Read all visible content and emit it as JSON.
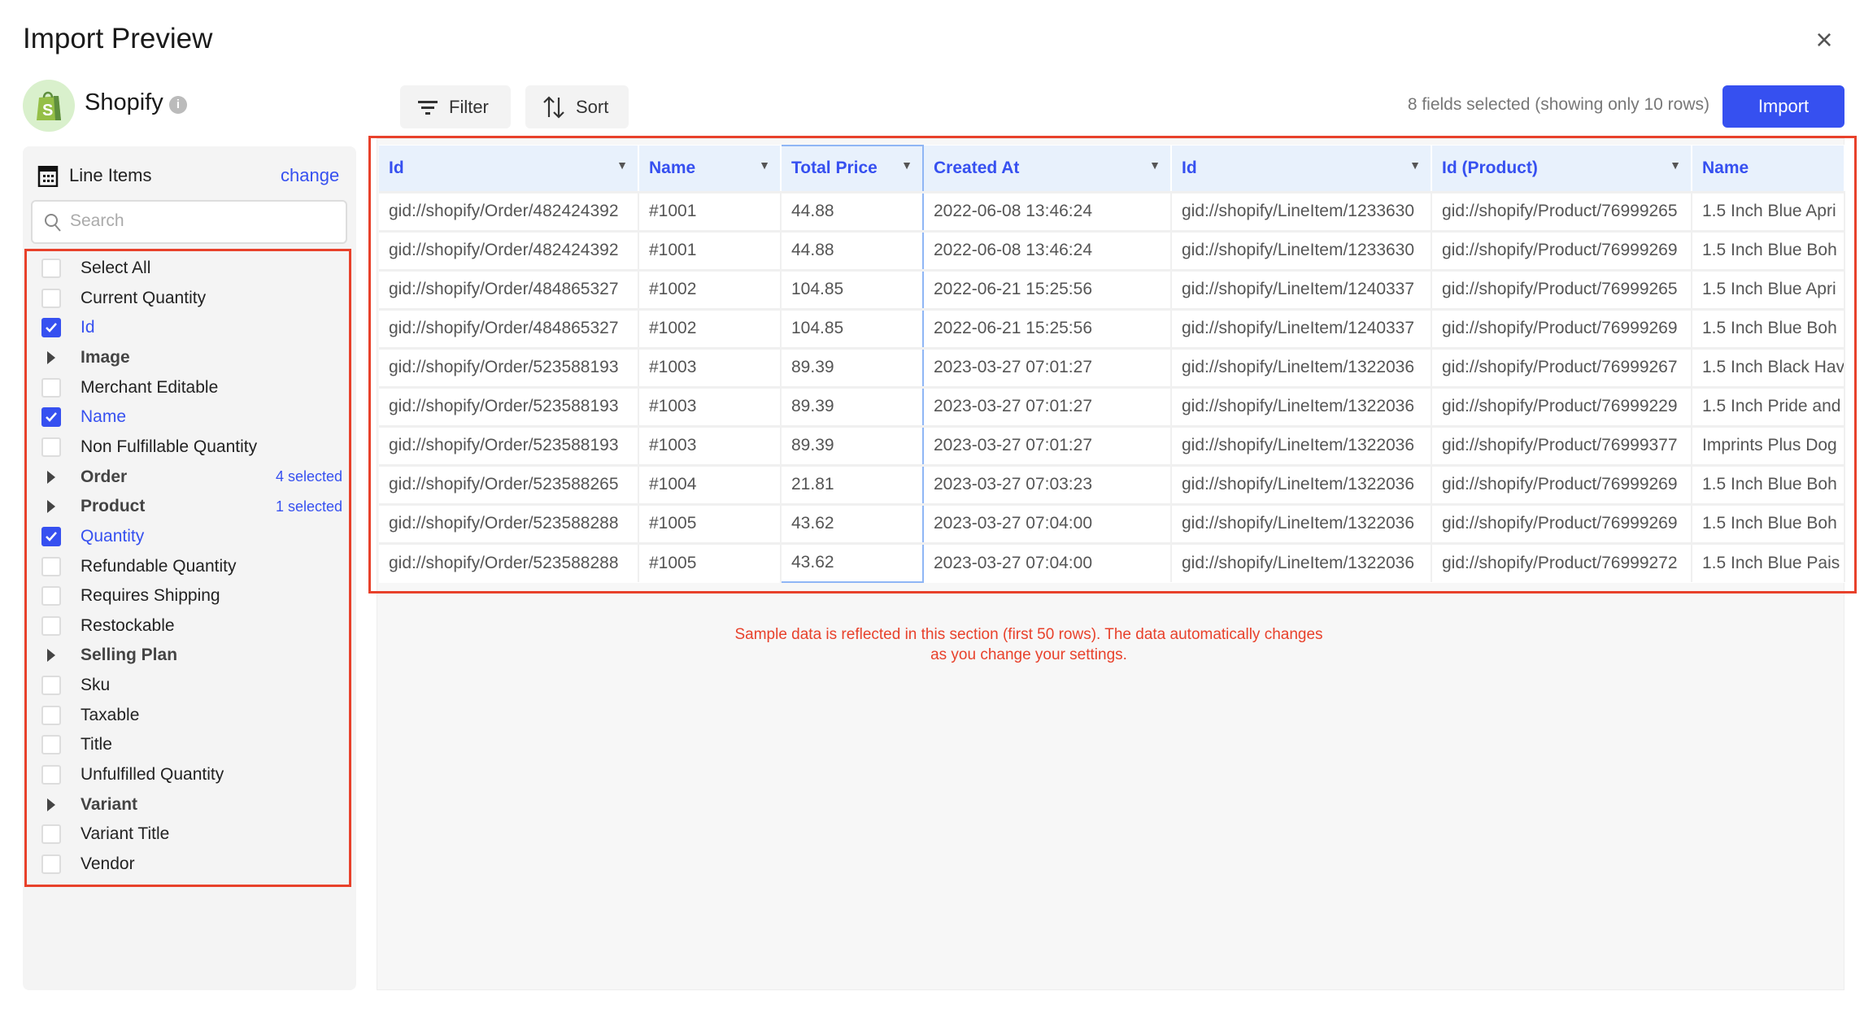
{
  "title": "Import Preview",
  "source": {
    "name": "Shopify",
    "info_icon": "info-icon"
  },
  "toolbar": {
    "filter_label": "Filter",
    "sort_label": "Sort",
    "status": "8 fields selected (showing only 10 rows)",
    "import_label": "Import"
  },
  "sidebar": {
    "entity": "Line Items",
    "change_label": "change",
    "search_placeholder": "Search",
    "fields": [
      {
        "label": "Select All",
        "type": "checkbox",
        "checked": false
      },
      {
        "label": "Current Quantity",
        "type": "checkbox",
        "checked": false
      },
      {
        "label": "Id",
        "type": "checkbox",
        "checked": true
      },
      {
        "label": "Image",
        "type": "group"
      },
      {
        "label": "Merchant Editable",
        "type": "checkbox",
        "checked": false
      },
      {
        "label": "Name",
        "type": "checkbox",
        "checked": true
      },
      {
        "label": "Non Fulfillable Quantity",
        "type": "checkbox",
        "checked": false
      },
      {
        "label": "Order",
        "type": "group",
        "count": "4 selected"
      },
      {
        "label": "Product",
        "type": "group",
        "count": "1 selected"
      },
      {
        "label": "Quantity",
        "type": "checkbox",
        "checked": true
      },
      {
        "label": "Refundable Quantity",
        "type": "checkbox",
        "checked": false
      },
      {
        "label": "Requires Shipping",
        "type": "checkbox",
        "checked": false
      },
      {
        "label": "Restockable",
        "type": "checkbox",
        "checked": false
      },
      {
        "label": "Selling Plan",
        "type": "group"
      },
      {
        "label": "Sku",
        "type": "checkbox",
        "checked": false
      },
      {
        "label": "Taxable",
        "type": "checkbox",
        "checked": false
      },
      {
        "label": "Title",
        "type": "checkbox",
        "checked": false
      },
      {
        "label": "Unfulfilled Quantity",
        "type": "checkbox",
        "checked": false
      },
      {
        "label": "Variant",
        "type": "group"
      },
      {
        "label": "Variant Title",
        "type": "checkbox",
        "checked": false
      },
      {
        "label": "Vendor",
        "type": "checkbox",
        "checked": false
      }
    ]
  },
  "table": {
    "columns": [
      "Id",
      "Name",
      "Total Price",
      "Created At",
      "Id",
      "Id (Product)",
      "Name"
    ],
    "rows": [
      [
        "gid://shopify/Order/482424392",
        "#1001",
        "44.88",
        "2022-06-08 13:46:24",
        "gid://shopify/LineItem/1233630",
        "gid://shopify/Product/76999265",
        "1.5 Inch Blue Apri"
      ],
      [
        "gid://shopify/Order/482424392",
        "#1001",
        "44.88",
        "2022-06-08 13:46:24",
        "gid://shopify/LineItem/1233630",
        "gid://shopify/Product/76999269",
        "1.5 Inch Blue Boh"
      ],
      [
        "gid://shopify/Order/484865327",
        "#1002",
        "104.85",
        "2022-06-21 15:25:56",
        "gid://shopify/LineItem/1240337",
        "gid://shopify/Product/76999265",
        "1.5 Inch Blue Apri"
      ],
      [
        "gid://shopify/Order/484865327",
        "#1002",
        "104.85",
        "2022-06-21 15:25:56",
        "gid://shopify/LineItem/1240337",
        "gid://shopify/Product/76999269",
        "1.5 Inch Blue Boh"
      ],
      [
        "gid://shopify/Order/523588193",
        "#1003",
        "89.39",
        "2023-03-27 07:01:27",
        "gid://shopify/LineItem/1322036",
        "gid://shopify/Product/76999267",
        "1.5 Inch Black Hav"
      ],
      [
        "gid://shopify/Order/523588193",
        "#1003",
        "89.39",
        "2023-03-27 07:01:27",
        "gid://shopify/LineItem/1322036",
        "gid://shopify/Product/76999229",
        "1.5 Inch Pride and"
      ],
      [
        "gid://shopify/Order/523588193",
        "#1003",
        "89.39",
        "2023-03-27 07:01:27",
        "gid://shopify/LineItem/1322036",
        "gid://shopify/Product/76999377",
        "Imprints Plus Dog"
      ],
      [
        "gid://shopify/Order/523588265",
        "#1004",
        "21.81",
        "2023-03-27 07:03:23",
        "gid://shopify/LineItem/1322036",
        "gid://shopify/Product/76999269",
        "1.5 Inch Blue Boh"
      ],
      [
        "gid://shopify/Order/523588288",
        "#1005",
        "43.62",
        "2023-03-27 07:04:00",
        "gid://shopify/LineItem/1322036",
        "gid://shopify/Product/76999269",
        "1.5 Inch Blue Boh"
      ],
      [
        "gid://shopify/Order/523588288",
        "#1005",
        "43.62",
        "2023-03-27 07:04:00",
        "gid://shopify/LineItem/1322036",
        "gid://shopify/Product/76999272",
        "1.5 Inch Blue Pais"
      ]
    ]
  },
  "note": "Sample data is reflected in this section (first 50 rows). The data automatically changes as you change your settings.",
  "colors": {
    "accent": "#3650f0",
    "highlight": "#e8412b",
    "header_bg": "#e8f1fc"
  }
}
